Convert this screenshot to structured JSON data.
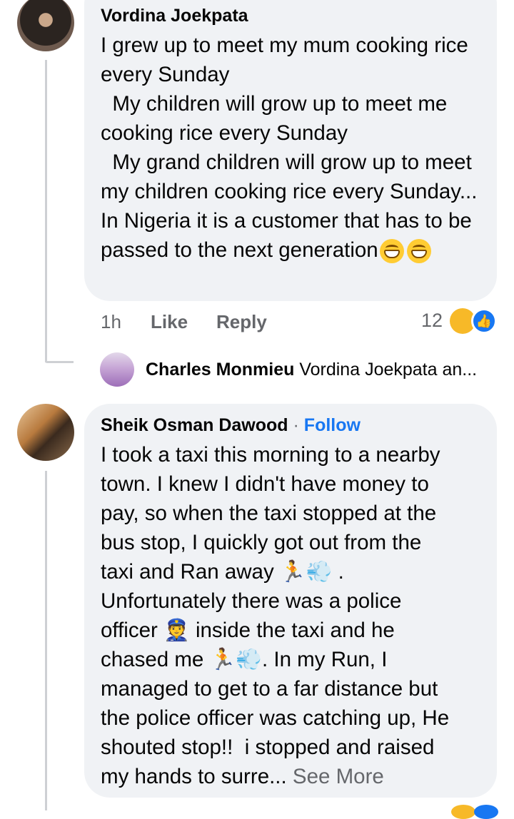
{
  "comments": [
    {
      "author": "Vordina Joekpata",
      "text": "I grew up to meet my mum cooking rice every Sunday\n  My children will grow up to meet me cooking rice every Sunday\n  My grand children will grow up to meet my children cooking rice every Sunday... In Nigeria it is a customer that has to be passed to the next generation",
      "emoji_end": "grinning-face-with-smiling-eyes x2",
      "time": "1h",
      "like_label": "Like",
      "reply_label": "Reply",
      "reaction_count": "12",
      "reactions": [
        "haha-icon",
        "like-icon"
      ]
    },
    {
      "author": "Sheik Osman Dawood",
      "follow_label": "Follow",
      "separator": "·",
      "text_lines": [
        "I took a taxi this morning to a nearby",
        "town. I knew I didn't have money to",
        "pay, so when the taxi stopped at the",
        "bus stop, I quickly got out from the",
        "taxi and Ran away",
        "Unfortunately there was a police",
        "officer",
        "inside the taxi and he",
        "chased me",
        ". In my Run, I",
        "managed to get to a far distance but",
        "the police officer was catching up, He",
        "shouted stop!!  i stopped and raised",
        "my hands to surre..."
      ],
      "see_more_label": "See More"
    }
  ],
  "reply_preview": {
    "author": "Charles Monmieu",
    "snippet": "Vordina Joekpata an..."
  },
  "colors": {
    "bubble": "#f0f2f5",
    "meta": "#65676b",
    "link": "#1877f2"
  }
}
